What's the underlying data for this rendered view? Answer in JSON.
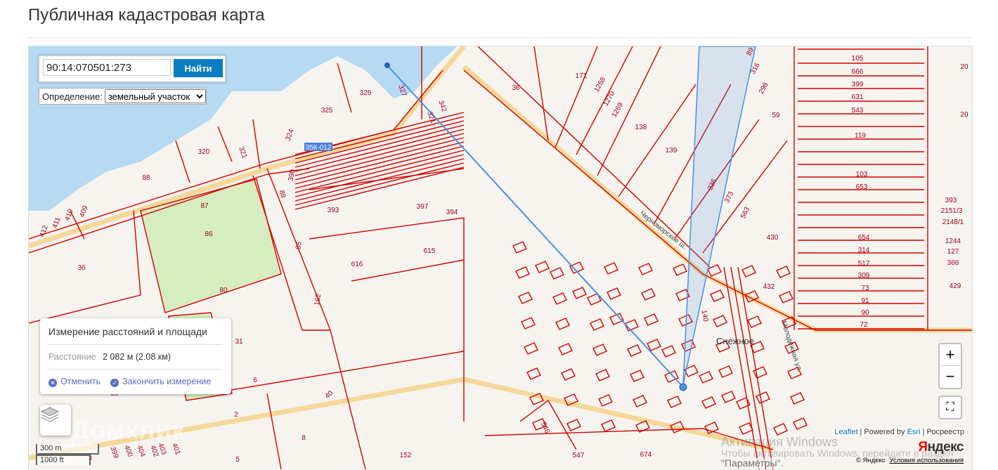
{
  "page_title": "Публичная кадастровая карта",
  "search": {
    "value": "90:14:070501:273",
    "button": "Найти"
  },
  "definition": {
    "label": "Определение:",
    "selected": "земельный участок"
  },
  "measure": {
    "title": "Измерение расстояний и площади",
    "distance_label": "Расстояние",
    "distance_value": "2 082 м (2.08 км)",
    "cancel": "Отменить",
    "finish": "Закончить измерение"
  },
  "scale": {
    "metric": "300 m",
    "imperial": "1000 ft"
  },
  "zoom": {
    "in": "+",
    "out": "−"
  },
  "attribution": {
    "leaflet": "Leaflet",
    "powered": "| Powered by",
    "esri": "Esri",
    "rosreestr": "| Росреестр"
  },
  "yandex": {
    "logo_first": "Я",
    "logo_rest": "ндекс",
    "copyright": "© Яндекс",
    "terms": "Условия использования"
  },
  "watermark": {
    "brand": "Домклик",
    "win1": "Активация Windows",
    "win2": "Чтобы активировать Windows, перейдите в раздел",
    "win3": "\"Параметры\"."
  },
  "map": {
    "road_badge": "35К-012",
    "place": "Снежное",
    "streets": [
      "Черноморское ш.",
      "Молодёжная ул."
    ],
    "parcels": [
      "326",
      "327",
      "325",
      "324",
      "320",
      "321",
      "88",
      "87",
      "86",
      "80",
      "36",
      "412",
      "411",
      "410",
      "409",
      "393",
      "397",
      "394",
      "615",
      "616",
      "390",
      "88",
      "85",
      "162",
      "31",
      "6",
      "2",
      "40",
      "8",
      "5",
      "152",
      "674",
      "546",
      "547",
      "36",
      "171",
      "1268",
      "1270",
      "1269",
      "138",
      "139",
      "336",
      "373",
      "563",
      "430",
      "432",
      "59",
      "298",
      "316",
      "89",
      "140",
      "105",
      "666",
      "399",
      "631",
      "543",
      "119",
      "103",
      "653",
      "654",
      "314",
      "517",
      "309",
      "73",
      "91",
      "90",
      "72",
      "393",
      "2151/3",
      "2148/1",
      "1244",
      "127",
      "366",
      "429",
      "20",
      "20",
      "342",
      "321",
      "59",
      "399",
      "400",
      "404",
      "402",
      "403",
      "401",
      "3"
    ]
  },
  "colors": {
    "water": "#b5daf2",
    "parcel": "#d40000",
    "road": "#f5d89a",
    "green": "#d6edc0",
    "measure": "#4a90e2"
  }
}
